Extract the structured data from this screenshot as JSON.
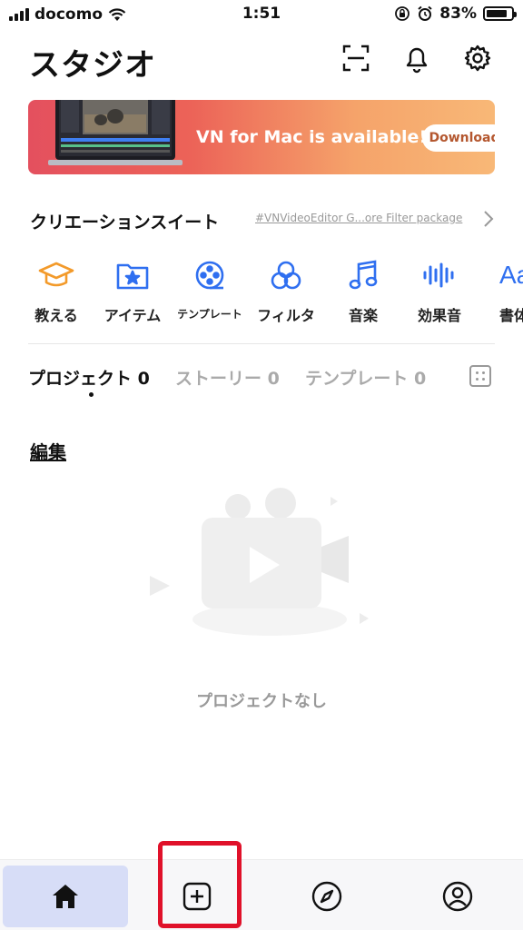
{
  "status": {
    "carrier": "docomo",
    "time": "1:51",
    "battery": "83%",
    "battery_level": 0.83
  },
  "header": {
    "title": "スタジオ",
    "icons": [
      "scan-icon",
      "bell-icon",
      "gear-icon"
    ]
  },
  "banner": {
    "text": "VN for Mac is available!",
    "button": "Download"
  },
  "suite": {
    "title": "クリエーションスイート",
    "link": "#VNVideoEditor G...ore Filter package",
    "tools": [
      {
        "label": "教える",
        "icon": "graduation-cap-icon",
        "color": "#f39a2a"
      },
      {
        "label": "アイテム",
        "icon": "star-folder-icon",
        "color": "#2f6ff0"
      },
      {
        "label": "テンプレート",
        "icon": "film-reel-icon",
        "color": "#2f6ff0"
      },
      {
        "label": "フィルタ",
        "icon": "filter-circles-icon",
        "color": "#2f6ff0"
      },
      {
        "label": "音楽",
        "icon": "music-note-icon",
        "color": "#2f6ff0"
      },
      {
        "label": "効果音",
        "icon": "waveform-icon",
        "color": "#2f6ff0"
      },
      {
        "label": "書体",
        "icon": "font-icon",
        "color": "#2f6ff0"
      }
    ]
  },
  "tabs": [
    {
      "label": "プロジェクト 0",
      "active": true
    },
    {
      "label": "ストーリー 0",
      "active": false
    },
    {
      "label": "テンプレート 0",
      "active": false
    }
  ],
  "edit_label": "編集",
  "empty_text": "プロジェクトなし",
  "bottom_nav": [
    {
      "name": "home",
      "icon": "home-icon",
      "active": true
    },
    {
      "name": "create",
      "icon": "plus-square-icon",
      "active": false
    },
    {
      "name": "discover",
      "icon": "compass-icon",
      "active": false
    },
    {
      "name": "profile",
      "icon": "person-circle-icon",
      "active": false
    }
  ],
  "colors": {
    "accent": "#2f6ff0",
    "orange": "#f39a2a",
    "annotation": "#e0112a",
    "nav_active_bg": "#d7ddf7"
  }
}
